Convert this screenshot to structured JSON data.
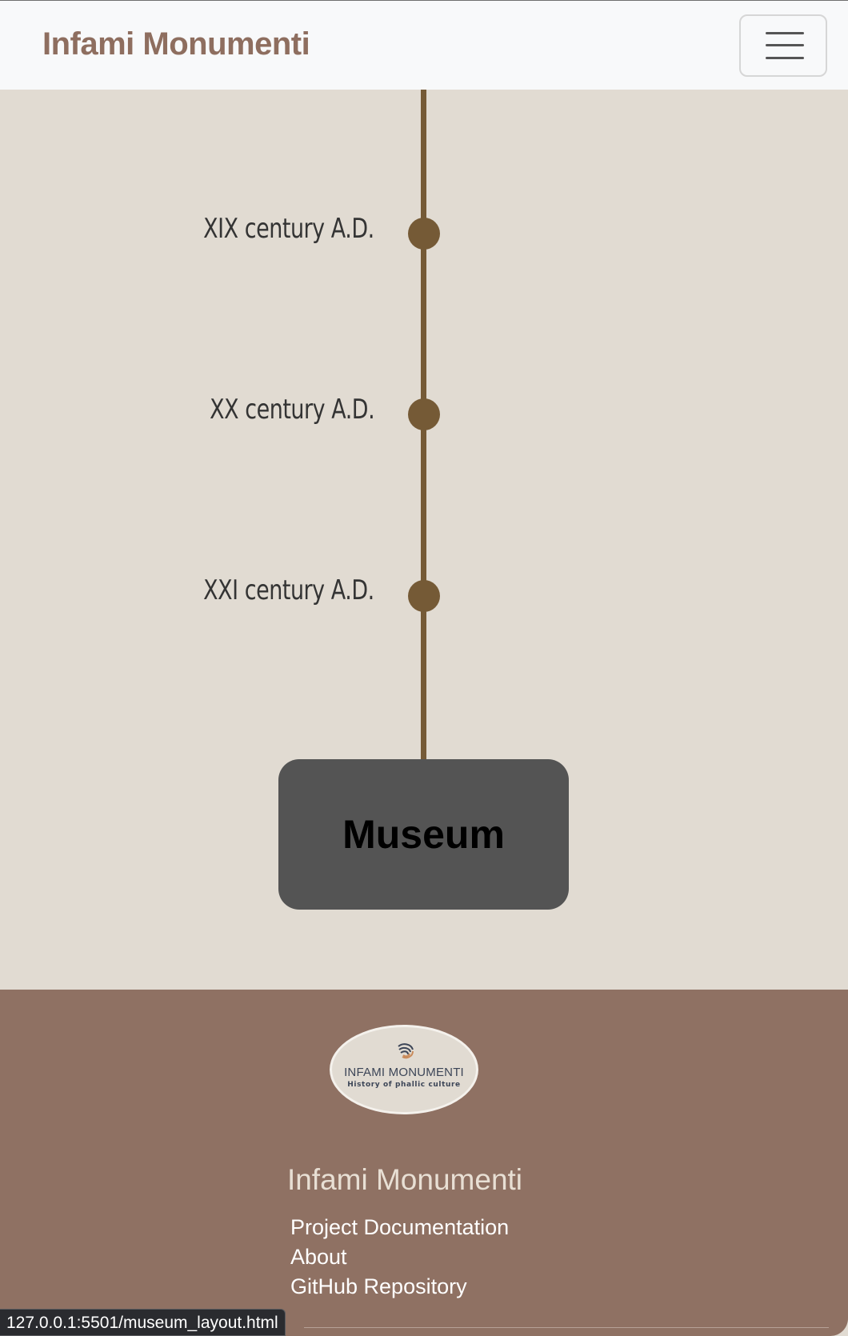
{
  "header": {
    "brand": "Infami Monumenti",
    "menu_icon": "hamburger-menu-icon"
  },
  "timeline": {
    "eras": [
      {
        "label": "XIX century A.D."
      },
      {
        "label": "XX century A.D."
      },
      {
        "label": "XXI century A.D."
      }
    ],
    "museum_label": "Museum"
  },
  "footer": {
    "logo": {
      "line1": "INFAMI MONUMENTI",
      "line2": "History of phallic culture",
      "mark_icon": "spiral-logo-icon"
    },
    "title": "Infami Monumenti",
    "links": [
      "Project Documentation",
      "About",
      "GitHub Repository"
    ]
  },
  "status_bar": {
    "url": "127.0.0.1:5501/museum_layout.html"
  },
  "colors": {
    "page_background": "#e1dbd2",
    "brand": "#8e6e5f",
    "timeline": "#755a36",
    "museum_button": "#545454",
    "footer": "#8f7163"
  }
}
